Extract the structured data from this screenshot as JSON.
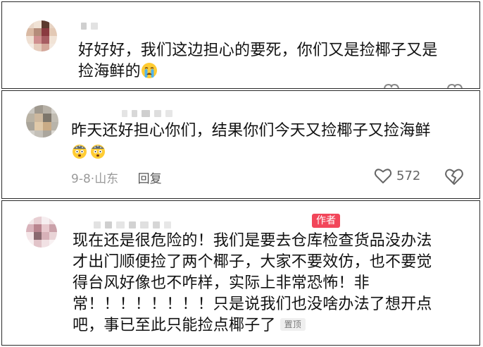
{
  "comments": [
    {
      "text_line1": "好好好，我们这边担心的要死，你们又是捡椰子又是",
      "text_line2": "捡海鲜的",
      "emoji": "crying-emoji"
    },
    {
      "text_line1": "昨天还好担心你们，结果你们今天又捡椰子又捡海鲜",
      "emoji": "shocked-emoji",
      "date": "9-8",
      "separator": "·",
      "location": "山东",
      "reply_label": "回复",
      "likes": "572"
    },
    {
      "author_badge": "作者",
      "text_line1": "现在还是很危险的！我们是要去仓库检查货品没办法",
      "text_line2": "才出门顺便捡了两个椰子，大家不要效仿，也不要觉",
      "text_line3": "得台风好像也不咋样，实际上非常恐怖！非",
      "text_line4": "常！！！！！！！！只是说我们也没啥办法了想开点",
      "text_line5": "吧，事已至此只能捡点椰子了",
      "pinned_badge": "置顶"
    }
  ],
  "colors": {
    "author_badge": "#f2465a",
    "meta_gray": "#9a9a9a"
  }
}
